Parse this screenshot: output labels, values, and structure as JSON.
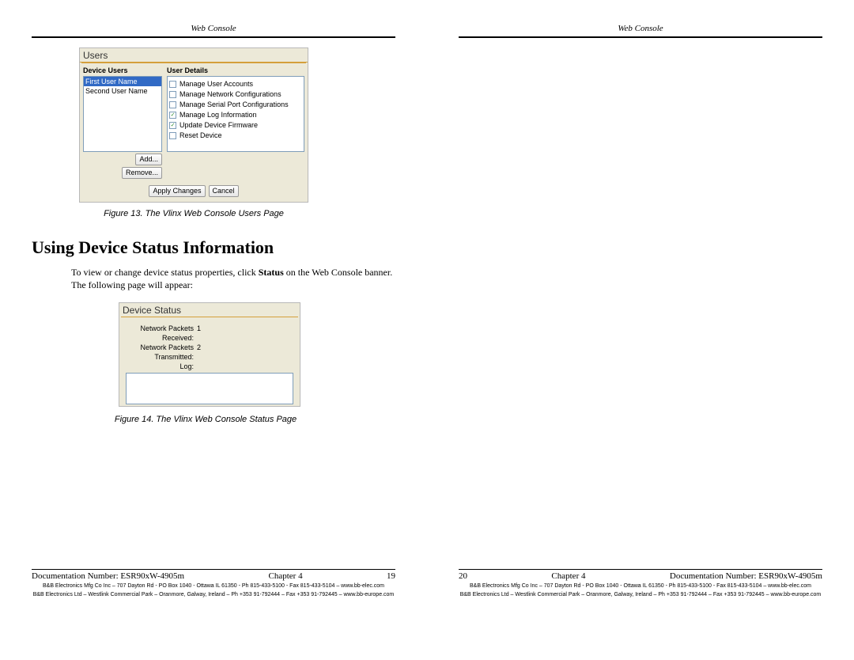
{
  "header": {
    "label": "Web Console"
  },
  "fig13": {
    "panel_title": "Users",
    "col_users": "Device Users",
    "col_details": "User Details",
    "users": [
      "First User Name",
      "Second User Name"
    ],
    "details": [
      {
        "checked": false,
        "label": "Manage User Accounts"
      },
      {
        "checked": false,
        "label": "Manage Network Configurations"
      },
      {
        "checked": false,
        "label": "Manage Serial Port Configurations"
      },
      {
        "checked": true,
        "label": "Manage Log Information"
      },
      {
        "checked": true,
        "label": "Update Device Firmware"
      },
      {
        "checked": false,
        "label": "Reset Device"
      }
    ],
    "btn_add": "Add...",
    "btn_remove": "Remove...",
    "btn_apply": "Apply Changes",
    "btn_cancel": "Cancel",
    "caption": "Figure 13.  The Vlinx Web Console Users Page"
  },
  "section_heading": "Using Device Status Information",
  "body1": "To view or change device status properties, click ",
  "body_bold": "Status",
  "body2": " on the Web Console banner. The following page will appear:",
  "fig14": {
    "panel_title": "Device Status",
    "row1l": "Network Packets Received:",
    "row1v": "1",
    "row2l": "Network Packets Transmitted:",
    "row2v": "2",
    "row3l": "Log:",
    "caption": "Figure 14.  The Vlinx Web Console Status Page"
  },
  "footer_left": {
    "doc": "Documentation Number:  ESR90xW-4905m",
    "chapter": "Chapter 4",
    "page": "19",
    "small1": "B&B Electronics Mfg Co Inc – 707 Dayton Rd - PO Box 1040 - Ottawa IL 61350 - Ph 815-433-5100 - Fax 815-433-5104 – www.bb-elec.com",
    "small2": "B&B Electronics Ltd – Westlink Commercial Park – Oranmore, Galway, Ireland – Ph +353 91-792444 – Fax +353 91-792445 – www.bb-europe.com"
  },
  "footer_right": {
    "page": "20",
    "chapter": "Chapter 4",
    "doc": "Documentation Number:  ESR90xW-4905m",
    "small1": "B&B Electronics Mfg Co Inc – 707 Dayton Rd - PO Box 1040 - Ottawa IL 61350 - Ph 815-433-5100 - Fax 815-433-5104 – www.bb-elec.com",
    "small2": "B&B Electronics Ltd – Westlink Commercial Park – Oranmore, Galway, Ireland – Ph +353 91-792444 – Fax +353 91-792445 – www.bb-europe.com"
  }
}
